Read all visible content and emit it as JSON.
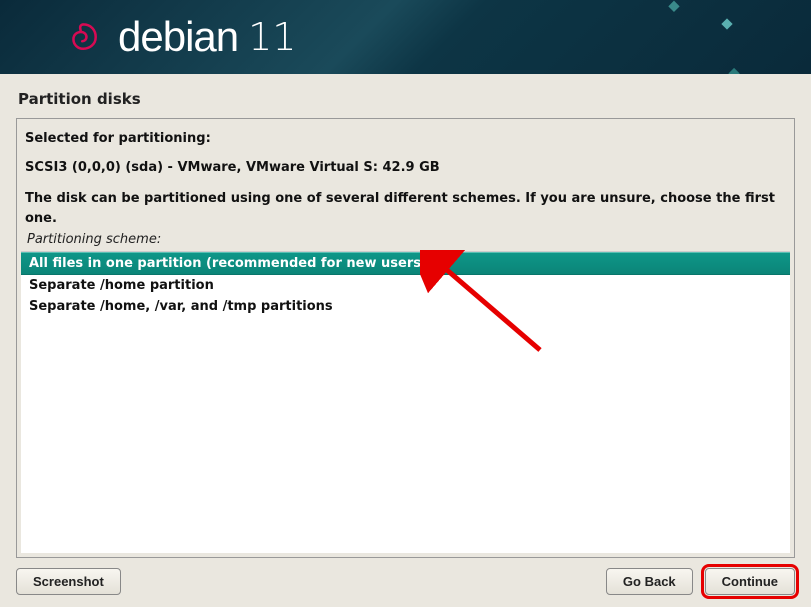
{
  "header": {
    "brand": "debian",
    "version": "11"
  },
  "title": "Partition disks",
  "panel": {
    "line1": "Selected for partitioning:",
    "line2": "SCSI3 (0,0,0) (sda) - VMware, VMware Virtual S: 42.9 GB",
    "line3": "The disk can be partitioned using one of several different schemes. If you are unsure, choose the first one.",
    "scheme_label": "Partitioning scheme:"
  },
  "options": [
    {
      "label": "All files in one partition (recommended for new users)",
      "selected": true
    },
    {
      "label": "Separate /home partition",
      "selected": false
    },
    {
      "label": "Separate /home, /var, and /tmp partitions",
      "selected": false
    }
  ],
  "buttons": {
    "screenshot": "Screenshot",
    "goback": "Go Back",
    "continue": "Continue"
  }
}
